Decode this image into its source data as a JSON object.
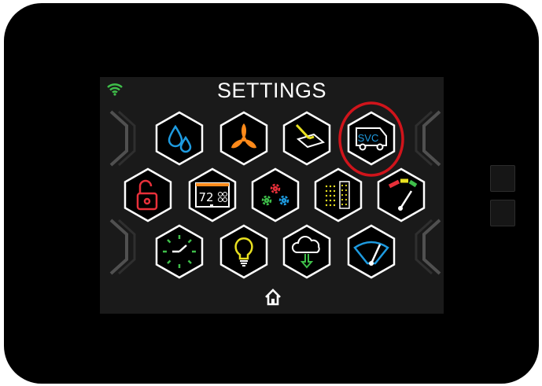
{
  "screen": {
    "title": "SETTINGS",
    "status": {
      "wifi": "wifi-icon",
      "wifi_color": "#3fbf4a"
    }
  },
  "tiles": [
    {
      "name": "water-drops-tile",
      "icon": "water-drops-icon",
      "color": "#1e9be0"
    },
    {
      "name": "fan-tile",
      "icon": "fan-icon",
      "color": "#ff8a1a"
    },
    {
      "name": "cleaning-tile",
      "icon": "cleaning-icon",
      "color": "#e8e020"
    },
    {
      "name": "service-tile",
      "icon": "service-van-icon",
      "label": "SVC",
      "color": "#1e9be0",
      "highlighted": true,
      "highlight_color": "#d0141b"
    },
    {
      "name": "lock-tile",
      "icon": "unlocked-padlock-icon",
      "color": "#e8303a"
    },
    {
      "name": "display-tile",
      "icon": "display-temperature-icon",
      "label": "72",
      "color": "#ffffff",
      "accent": "#ff8a1a"
    },
    {
      "name": "gears-tile",
      "icon": "gears-icon",
      "colors": [
        "#e8303a",
        "#3fbf4a",
        "#1e9be0"
      ]
    },
    {
      "name": "dots-panel-tile",
      "icon": "dot-matrix-icon",
      "color": "#e8e020"
    },
    {
      "name": "gauge-tile",
      "icon": "gauge-icon",
      "colors": [
        "#e8303a",
        "#e8e020",
        "#3fbf4a"
      ]
    },
    {
      "name": "clock-tile",
      "icon": "clock-icon",
      "color": "#3fbf4a"
    },
    {
      "name": "lightbulb-tile",
      "icon": "lightbulb-icon",
      "color": "#e8e020"
    },
    {
      "name": "cloud-download-tile",
      "icon": "cloud-download-icon",
      "color": "#3fbf4a"
    },
    {
      "name": "wiper-tile",
      "icon": "wiper-icon",
      "color": "#1e9be0"
    }
  ],
  "nav": {
    "home": "home-icon"
  }
}
